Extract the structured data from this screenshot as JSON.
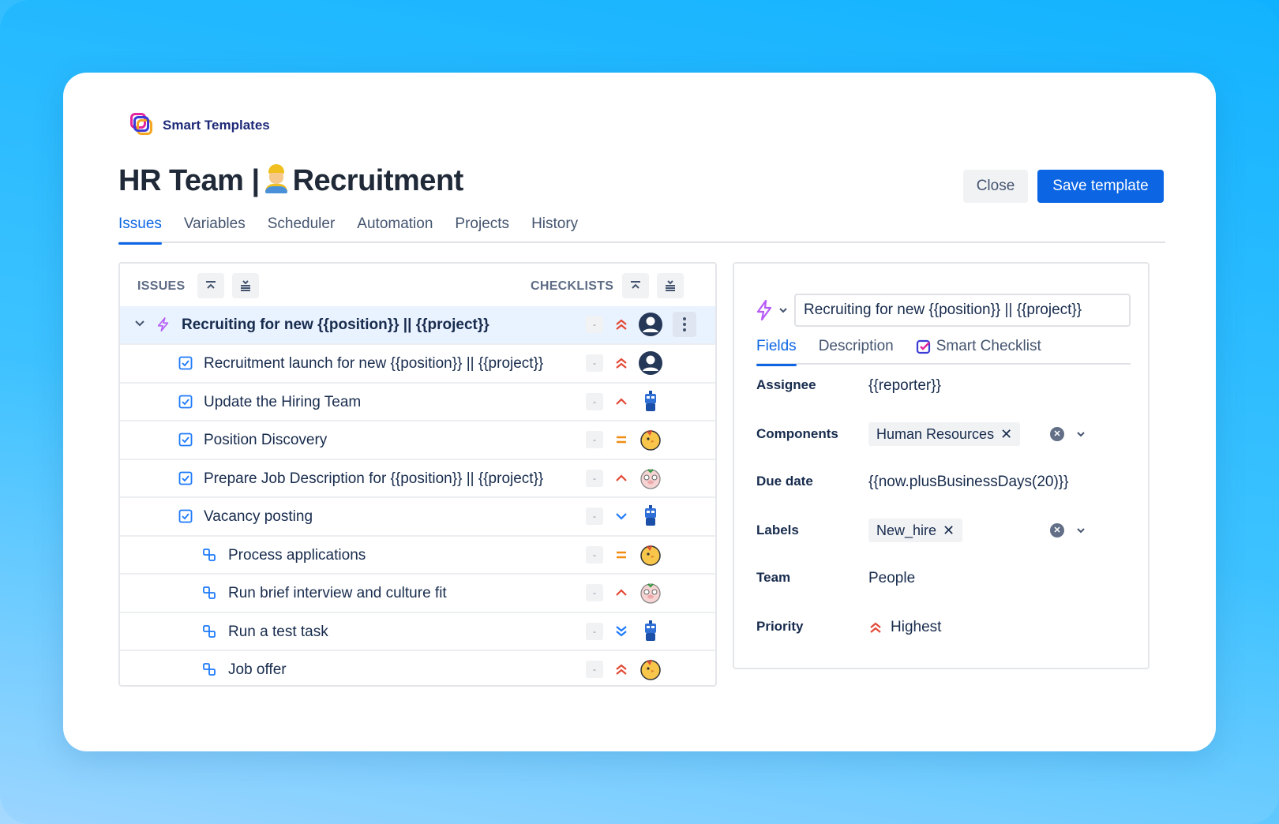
{
  "brand": {
    "name": "Smart Templates"
  },
  "page": {
    "title_prefix": "HR Team |",
    "title_suffix": "Recruitment"
  },
  "actions": {
    "close_label": "Close",
    "save_label": "Save template"
  },
  "tabs": [
    {
      "label": "Issues",
      "active": true
    },
    {
      "label": "Variables"
    },
    {
      "label": "Scheduler"
    },
    {
      "label": "Automation"
    },
    {
      "label": "Projects"
    },
    {
      "label": "History"
    }
  ],
  "issues_panel": {
    "issues_header": "ISSUES",
    "checklists_header": "CHECKLISTS",
    "rows": [
      {
        "type": "epic",
        "text": "Recruiting for new {{position}} || {{project}}",
        "checklist": "-",
        "priority": "highest",
        "avatar": "default-user"
      },
      {
        "type": "task",
        "text": "Recruitment launch for new {{position}} || {{project}}",
        "checklist": "-",
        "priority": "highest",
        "avatar": "default-user"
      },
      {
        "type": "task",
        "text": "Update the Hiring Team",
        "checklist": "-",
        "priority": "high",
        "avatar": "robot"
      },
      {
        "type": "task",
        "text": "Position Discovery",
        "checklist": "-",
        "priority": "medium",
        "avatar": "chick"
      },
      {
        "type": "task",
        "text": "Prepare Job Description for {{position}} || {{project}}",
        "checklist": "-",
        "priority": "high",
        "avatar": "pig"
      },
      {
        "type": "task",
        "text": "Vacancy posting",
        "checklist": "-",
        "priority": "low",
        "avatar": "robot"
      },
      {
        "type": "subtask",
        "text": "Process applications",
        "checklist": "-",
        "priority": "medium",
        "avatar": "chick"
      },
      {
        "type": "subtask",
        "text": "Run brief interview and culture fit",
        "checklist": "-",
        "priority": "high",
        "avatar": "pig"
      },
      {
        "type": "subtask",
        "text": "Run a test task",
        "checklist": "-",
        "priority": "lowest",
        "avatar": "robot"
      },
      {
        "type": "subtask",
        "text": "Job offer",
        "checklist": "-",
        "priority": "highest",
        "avatar": "chick"
      }
    ]
  },
  "details": {
    "summary_value": "Recruiting for new {{position}} || {{project}}",
    "tabs": [
      {
        "label": "Fields",
        "active": true
      },
      {
        "label": "Description"
      },
      {
        "label": "Smart Checklist"
      }
    ],
    "fields": {
      "assignee": {
        "label": "Assignee",
        "value": "{{reporter}}"
      },
      "components": {
        "label": "Components",
        "chip": "Human Resources"
      },
      "due_date": {
        "label": "Due date",
        "value": "{{now.plusBusinessDays(20)}}"
      },
      "labels": {
        "label": "Labels",
        "chip": "New_hire"
      },
      "team": {
        "label": "Team",
        "value": "People"
      },
      "priority": {
        "label": "Priority",
        "value": "Highest"
      }
    }
  },
  "colors": {
    "accent": "#0c66e4",
    "priority_highest": "#e34935",
    "priority_medium": "#f18d13",
    "priority_low": "#1d7afc",
    "bolt": "#b65cf6"
  }
}
